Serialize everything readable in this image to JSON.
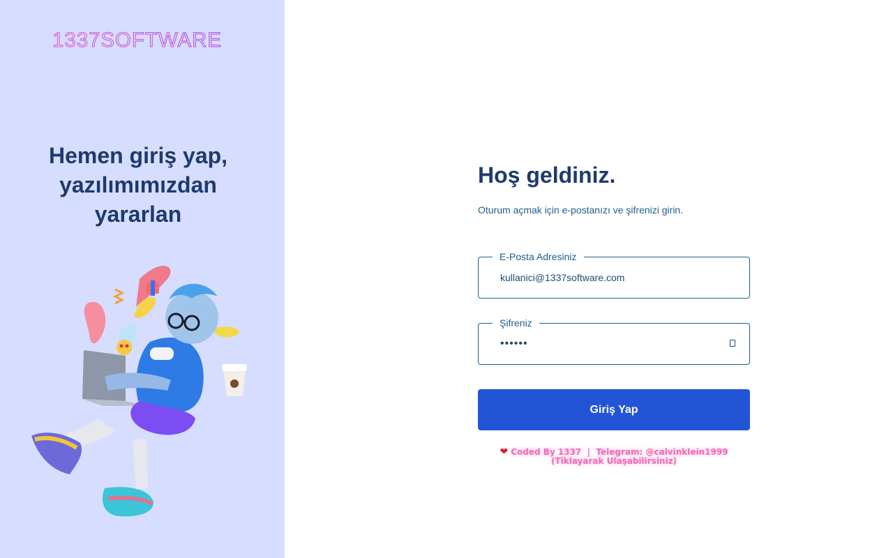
{
  "brand": {
    "logo_text": "1337SOFTWARE"
  },
  "left_panel": {
    "tagline": "Hemen giriş yap, yazılımımızdan yararlan"
  },
  "login": {
    "title": "Hoş geldiniz.",
    "subtitle": "Oturum açmak için e-postanızı ve şifrenizi girin.",
    "email_label": "E-Posta Adresiniz",
    "email_value": "kullanici@1337software.com",
    "password_label": "Şifreniz",
    "password_value": "••••••",
    "submit_label": "Giriş Yap"
  },
  "footer": {
    "credit_line1": "Coded By 1337  |  Telegram: @calvinklein1999",
    "credit_line2": "(Tiklayarak Ulaşabilirsiniz)"
  },
  "colors": {
    "left_bg": "#d7ddfe",
    "heading": "#1e3a6e",
    "accent_text": "#1d5f8c",
    "button_bg": "#2454d6",
    "credit_pink": "#f06ab8",
    "logo_gradient": [
      "#e060c8",
      "#b050e0"
    ]
  },
  "icons": {
    "password_toggle": "eye-toggle-icon",
    "credit": "heart-icon"
  }
}
